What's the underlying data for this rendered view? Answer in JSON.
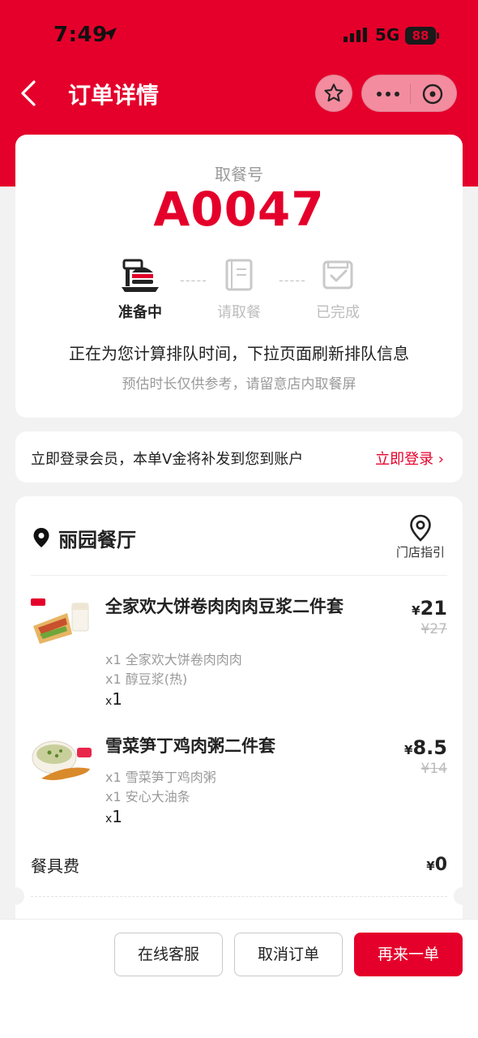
{
  "status_bar": {
    "time": "7:49",
    "network": "5G",
    "battery": "88"
  },
  "header": {
    "title": "订单详情"
  },
  "pickup": {
    "label": "取餐号",
    "number": "A0047",
    "steps": [
      {
        "label": "准备中",
        "icon": "burger-tray-icon",
        "state": "active"
      },
      {
        "label": "请取餐",
        "icon": "bag-icon",
        "state": "pending"
      },
      {
        "label": "已完成",
        "icon": "check-bag-icon",
        "state": "pending"
      }
    ],
    "queue_text": "正在为您计算排队时间，下拉页面刷新排队信息",
    "queue_sub": "预估时长仅供参考，请留意店内取餐屏"
  },
  "member": {
    "text": "立即登录会员，本单V金将补发到您到账户",
    "login_label": "立即登录 ›"
  },
  "store": {
    "name": "丽园餐厅",
    "guide_label": "门店指引"
  },
  "items": [
    {
      "name": "全家欢大饼卷肉肉肉豆浆二件套",
      "subs": [
        "x1 全家欢大饼卷肉肉肉",
        "x1 醇豆浆(热)"
      ],
      "qty_x": "x",
      "qty_n": "1",
      "price_symbol": "¥",
      "price": "21",
      "orig_price": "¥27"
    },
    {
      "name": "雪菜笋丁鸡肉粥二件套",
      "subs": [
        "x1 雪菜笋丁鸡肉粥",
        "x1 安心大油条"
      ],
      "qty_x": "x",
      "qty_n": "1",
      "price_symbol": "¥",
      "price": "8.5",
      "orig_price": "¥14"
    }
  ],
  "fee": {
    "label": "餐具费",
    "symbol": "¥",
    "amount": "0"
  },
  "actions": {
    "service": "在线客服",
    "cancel": "取消订单",
    "reorder": "再来一单"
  },
  "colors": {
    "brand": "#e4002b",
    "background": "#f2f2f2"
  }
}
